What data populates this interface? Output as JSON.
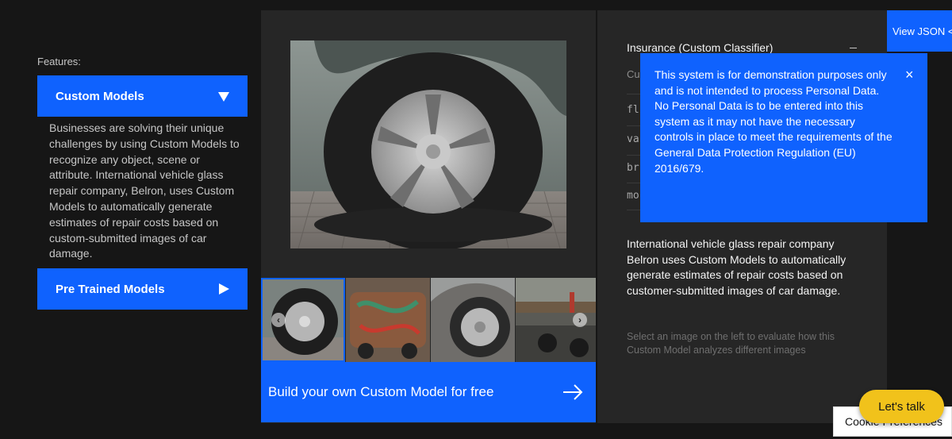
{
  "features": {
    "label": "Features:",
    "custom_models": {
      "label": "Custom Models",
      "expanded_icon": "chevron-down-icon",
      "description": "Businesses are solving their unique challenges by using Custom Models to recognize any object, scene or attribute. International vehicle glass repair company, Belron, uses Custom Models to automatically generate estimates of repair costs based on custom-submitted images of car damage."
    },
    "pre_trained": {
      "label": "Pre Trained Models",
      "icon": "chevron-right-icon"
    }
  },
  "demo": {
    "main_image": "flat-tire-photo",
    "thumbnails": [
      {
        "name": "flat-tire-thumb",
        "selected": true
      },
      {
        "name": "graffiti-car-thumb",
        "selected": false
      },
      {
        "name": "car-wheel-thumb",
        "selected": false
      },
      {
        "name": "motorcycle-street-thumb",
        "selected": false
      }
    ],
    "build_cta": "Build your own Custom Model for free"
  },
  "results": {
    "classifier_title": "Insurance (Custom Classifier)",
    "custom_label": "Cu",
    "rows": [
      "fl",
      "va",
      "br",
      "mo"
    ],
    "description": "International vehicle glass repair company Belron uses Custom Models to automatically generate estimates of repair costs based on customer-submitted images of car damage.",
    "hint": "Select an image on the left to evaluate how this Custom Model analyzes different images"
  },
  "view_json": "View JSON <",
  "notice": {
    "text": "This system is for demonstration purposes only and is not intended to process Personal Data. No Personal Data is to be entered into this system as it may not have the necessary controls in place to meet the requirements of the General Data Protection Regulation (EU) 2016/679.",
    "close": "×"
  },
  "cookie": "Cookie Preferences",
  "lets_talk": "Let's talk",
  "colors": {
    "background": "#161616",
    "panel": "#262626",
    "accent": "#0f62fe",
    "chat_button": "#f1c21b"
  }
}
